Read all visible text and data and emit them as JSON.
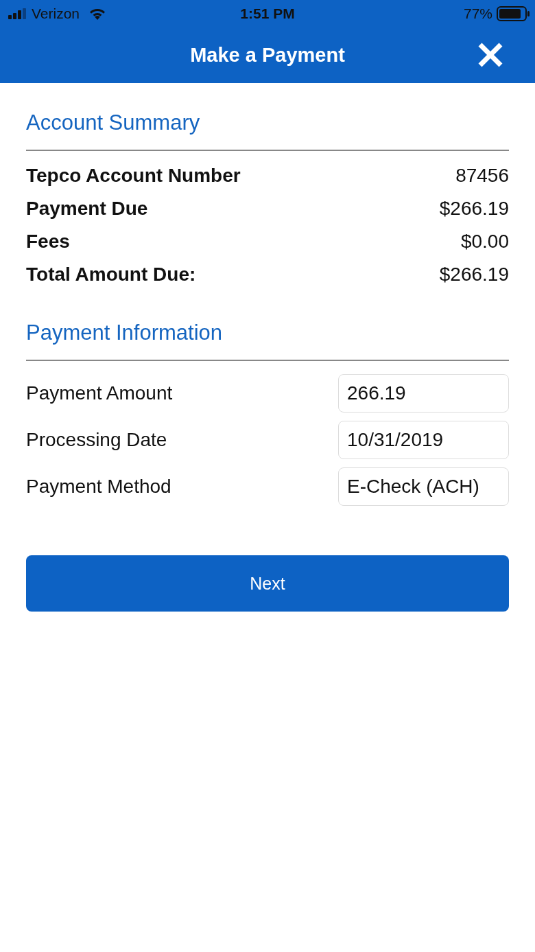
{
  "status_bar": {
    "carrier": "Verizon",
    "time": "1:51 PM",
    "battery": "77%"
  },
  "header": {
    "title": "Make a Payment"
  },
  "account_summary": {
    "title": "Account Summary",
    "rows": [
      {
        "label": "Tepco Account Number",
        "value": "87456"
      },
      {
        "label": "Payment Due",
        "value": "$266.19"
      },
      {
        "label": "Fees",
        "value": "$0.00"
      },
      {
        "label": "Total Amount Due:",
        "value": "$266.19"
      }
    ]
  },
  "payment_information": {
    "title": "Payment Information",
    "fields": [
      {
        "label": "Payment Amount",
        "value": "266.19"
      },
      {
        "label": "Processing Date",
        "value": "10/31/2019"
      },
      {
        "label": "Payment Method",
        "value": "E-Check (ACH)"
      }
    ]
  },
  "next_button": {
    "label": "Next"
  }
}
